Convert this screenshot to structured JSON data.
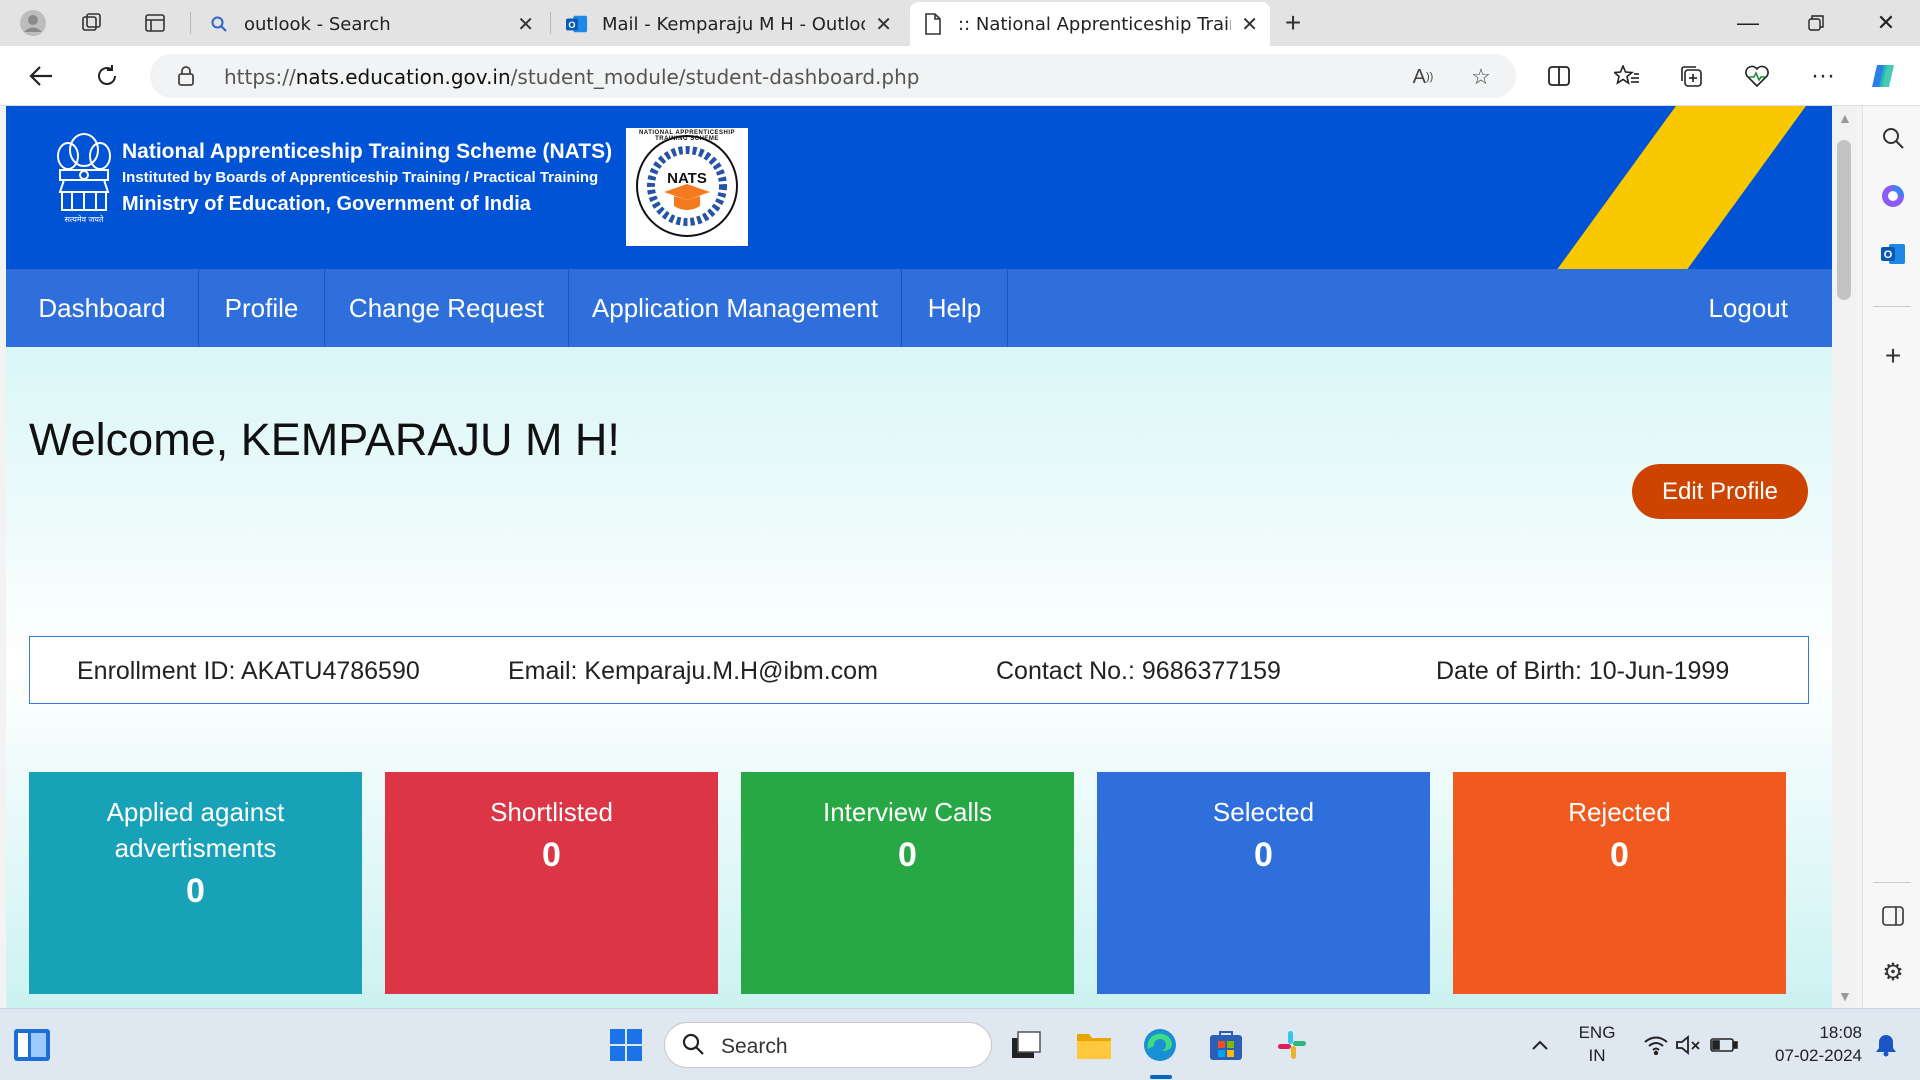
{
  "browser": {
    "tabs": [
      {
        "title": "outlook - Search",
        "icon": "search-icon"
      },
      {
        "title": "Mail - Kemparaju M H - Outlook",
        "icon": "outlook-icon"
      },
      {
        "title": ":: National Apprenticeship Training Scheme",
        "icon": "page-icon",
        "active": true
      }
    ],
    "url_scheme": "https://",
    "url_host": "nats.education.gov.in",
    "url_path": "/student_module/student-dashboard.php"
  },
  "header": {
    "line1": "National Apprenticeship Training Scheme (NATS)",
    "line2": "Instituted by Boards of Apprenticeship Training / Practical Training",
    "line3": "Ministry of Education, Government of India",
    "logo_text": "NATS",
    "logo_ring_text": "NATIONAL APPRENTICESHIP TRAINING SCHEME",
    "emblem_caption": "सत्यमेव जयते"
  },
  "nav": {
    "items": [
      "Dashboard",
      "Profile",
      "Change Request",
      "Application Management",
      "Help"
    ],
    "logout": "Logout"
  },
  "welcome": "Welcome, KEMPARAJU M H!",
  "edit_profile": "Edit Profile",
  "info": {
    "enrollment": "Enrollment ID: AKATU4786590",
    "email": "Email: Kemparaju.M.H@ibm.com",
    "contact": "Contact No.: 9686377159",
    "dob": "Date of Birth: 10-Jun-1999"
  },
  "cards": [
    {
      "label": "Applied against advertisments",
      "count": "0",
      "color": "#17a2b8"
    },
    {
      "label": "Shortlisted",
      "count": "0",
      "color": "#dc3545"
    },
    {
      "label": "Interview Calls",
      "count": "0",
      "color": "#28a745"
    },
    {
      "label": "Selected",
      "count": "0",
      "color": "#2f6fdb"
    },
    {
      "label": "Rejected",
      "count": "0",
      "color": "#f05a1f"
    }
  ],
  "taskbar": {
    "search_placeholder": "Search",
    "lang_top": "ENG",
    "lang_bottom": "IN",
    "time": "18:08",
    "date": "07-02-2024"
  }
}
